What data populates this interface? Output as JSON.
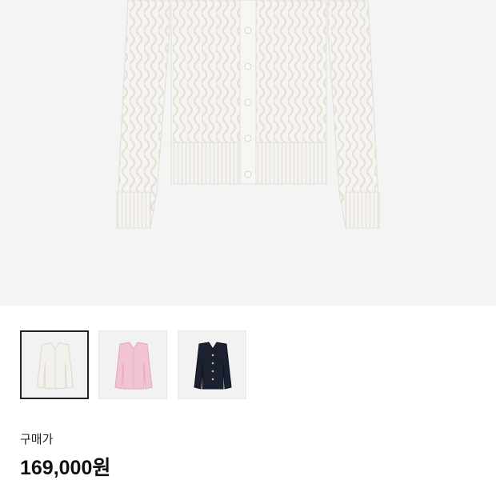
{
  "product": {
    "image_desc": "cable-knit-cardigan-ivory",
    "selected_color": "ivory"
  },
  "colors": [
    {
      "name": "ivory",
      "hex": "#f3f1ec",
      "selected": true
    },
    {
      "name": "pink",
      "hex": "#f2c3d1",
      "selected": false
    },
    {
      "name": "navy",
      "hex": "#1b2130",
      "selected": false
    }
  ],
  "price": {
    "label": "구매가",
    "value": "169,000원"
  }
}
